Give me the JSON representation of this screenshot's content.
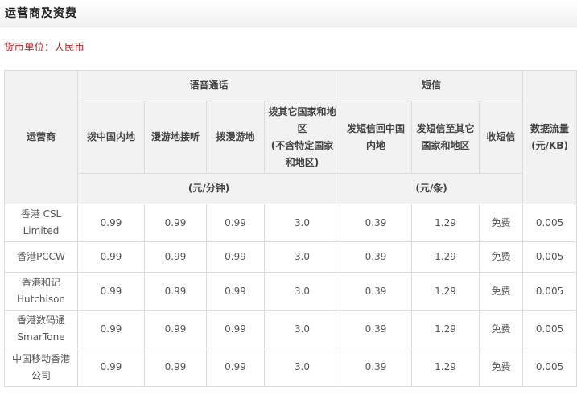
{
  "page": {
    "title": "运营商及资费",
    "currency": "货币单位：人民币"
  },
  "table": {
    "operator_header": "运营商",
    "voice_group": "语音通话",
    "sms_group": "短信",
    "data_header": "数据流量",
    "data_unit": "(元/KB)",
    "voice_columns": [
      "拨中国内地",
      "漫游地接听",
      "拨漫游地",
      "拨其它国家和地区",
      "(不含特定国家和地区)"
    ],
    "sms_columns": [
      "发短信回中国内地",
      "发短信至其它国家和地区",
      "收短信"
    ],
    "voice_unit": "(元/分钟)",
    "sms_unit": "(元/条)",
    "rows": [
      {
        "operator": "香港 CSL",
        "operator_sub": "Limited",
        "values": [
          "0.99",
          "0.99",
          "0.99",
          "3.0",
          "0.39",
          "1.29",
          "免费",
          "0.005"
        ]
      },
      {
        "operator": "香港PCCW",
        "operator_sub": "",
        "values": [
          "0.99",
          "0.99",
          "0.99",
          "3.0",
          "0.39",
          "1.29",
          "免费",
          "0.005"
        ]
      },
      {
        "operator": "香港和记",
        "operator_sub": "Hutchison",
        "values": [
          "0.99",
          "0.99",
          "0.99",
          "3.0",
          "0.39",
          "1.29",
          "免费",
          "0.005"
        ]
      },
      {
        "operator": "香港数码通",
        "operator_sub": "SmarTone",
        "values": [
          "0.99",
          "0.99",
          "0.99",
          "3.0",
          "0.39",
          "1.29",
          "免费",
          "0.005"
        ]
      },
      {
        "operator": "中国移动香港",
        "operator_sub": "公司",
        "values": [
          "0.99",
          "0.99",
          "0.99",
          "3.0",
          "0.39",
          "1.29",
          "免费",
          "0.005"
        ]
      }
    ]
  }
}
